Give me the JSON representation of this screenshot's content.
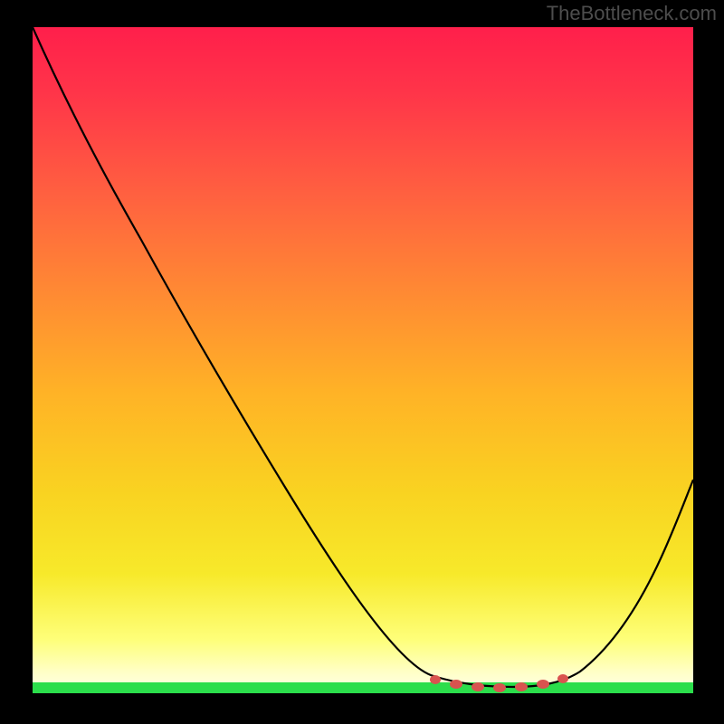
{
  "watermark": "TheBottleneck.com",
  "chart_data": {
    "type": "line",
    "title": "",
    "xlabel": "",
    "ylabel": "",
    "xlim": [
      0,
      100
    ],
    "ylim": [
      0,
      100
    ],
    "series": [
      {
        "name": "bottleneck-curve",
        "x": [
          0,
          16,
          38,
          60,
          66,
          73,
          80,
          83,
          100
        ],
        "y": [
          100,
          68,
          31,
          3,
          1.5,
          1,
          1.5,
          3.3,
          32
        ]
      }
    ],
    "markers": {
      "name": "optimal-region",
      "x": [
        61,
        64,
        67.5,
        70.5,
        74,
        77.5,
        80.5
      ],
      "y": [
        2.0,
        1.4,
        1.0,
        0.8,
        1.0,
        1.4,
        2.2
      ],
      "color": "#d9534f"
    },
    "background_gradient": {
      "direction": "vertical",
      "stops": [
        {
          "pos": 0.0,
          "color": "#ff1f4b"
        },
        {
          "pos": 0.25,
          "color": "#ff6040"
        },
        {
          "pos": 0.55,
          "color": "#ffb326"
        },
        {
          "pos": 0.82,
          "color": "#f7e92a"
        },
        {
          "pos": 0.97,
          "color": "#ffffc9"
        }
      ]
    },
    "green_strip_color": "#2bde4b",
    "frame_color": "#000000"
  }
}
